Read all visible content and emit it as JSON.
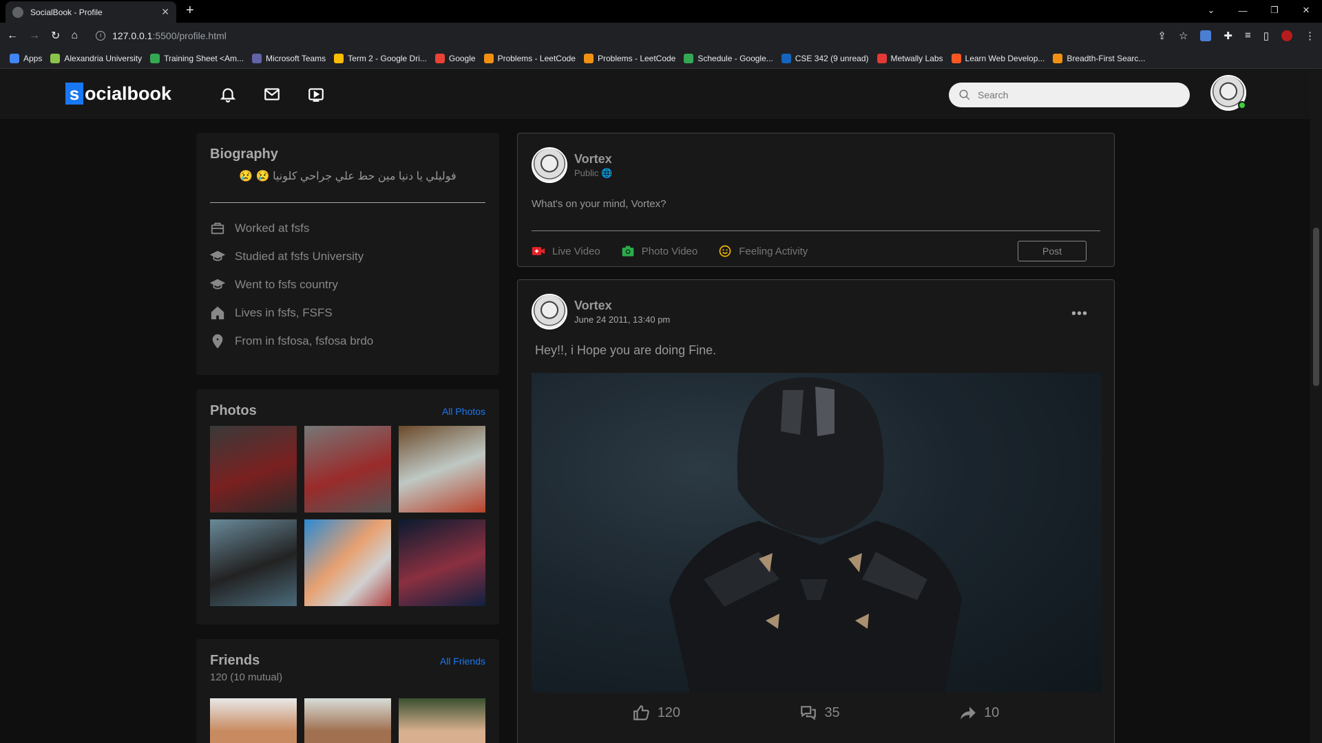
{
  "browser": {
    "tab_title": "SocialBook - Profile",
    "url_host": "127.0.0.1",
    "url_rest": ":5500/profile.html",
    "bookmarks": [
      "Apps",
      "Alexandria University",
      "Training Sheet <Am...",
      "Microsoft Teams",
      "Term 2 - Google Dri...",
      "Google",
      "Problems - LeetCode",
      "Problems - LeetCode",
      "Schedule - Google...",
      "CSE 342 (9 unread)",
      "Metwally Labs",
      "Learn Web Develop...",
      "Breadth-First Searc..."
    ],
    "bookmark_colors": [
      "#4285f4",
      "#8bc34a",
      "#34a853",
      "#6264a7",
      "#fbbc04",
      "#ea4335",
      "#f29111",
      "#f29111",
      "#34a853",
      "#1565c0",
      "#e53935",
      "#ff5722",
      "#f29111"
    ]
  },
  "site": {
    "logo_letter": "s",
    "logo_rest": "ocialbook",
    "search_placeholder": "Search",
    "accent": "#1877f2"
  },
  "bio": {
    "title": "Biography",
    "text": "فوليلي يا دنيا مين حط علي جراحي كلونيا 😢 😢",
    "items": [
      {
        "icon": "briefcase-icon",
        "label": "Worked at fsfs"
      },
      {
        "icon": "graduation-cap-icon",
        "label": "Studied at fsfs University"
      },
      {
        "icon": "graduation-cap-icon",
        "label": "Went to fsfs country"
      },
      {
        "icon": "home-icon",
        "label": "Lives in fsfs, FSFS"
      },
      {
        "icon": "location-pin-icon",
        "label": "From in fsfosa, fsfosa brdo"
      }
    ]
  },
  "photos": {
    "title": "Photos",
    "link": "All Photos"
  },
  "friends": {
    "title": "Friends",
    "link": "All Friends",
    "count": "120 (10 mutual)"
  },
  "create_post": {
    "name": "Vortex",
    "visibility": "Public",
    "prompt": "What's on your mind, Vortex?",
    "live": "Live Video",
    "photo": "Photo Video",
    "feeling": "Feeling Activity",
    "post_button": "Post"
  },
  "post": {
    "name": "Vortex",
    "date": "June 24 2011, 13:40 pm",
    "text": "Hey!!, i Hope you are doing Fine.",
    "likes": "120",
    "comments": "35",
    "shares": "10"
  }
}
